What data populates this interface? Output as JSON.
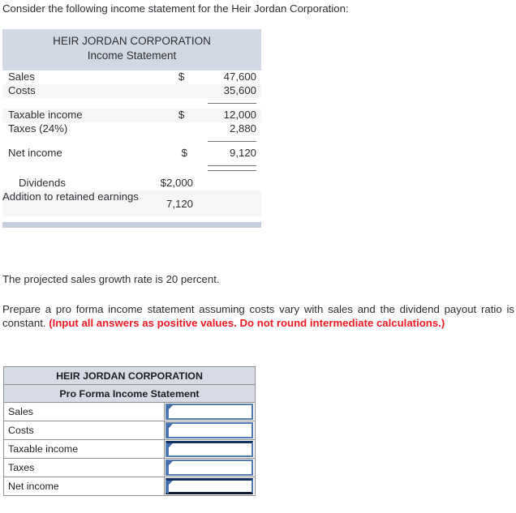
{
  "intro": {
    "text": "Consider the following income statement for the Heir Jordan Corporation:"
  },
  "income_statement": {
    "company": "HEIR JORDAN CORPORATION",
    "subtitle": "Income Statement",
    "rows": [
      {
        "label": "Sales",
        "currency": "$",
        "value": "47,600"
      },
      {
        "label": "Costs",
        "currency": "",
        "value": "35,600"
      },
      {
        "label": "Taxable income",
        "currency": "$",
        "value": "12,000"
      },
      {
        "label": "Taxes (24%)",
        "currency": "",
        "value": "2,880"
      },
      {
        "label": "Net income",
        "currency": "$",
        "value": "9,120"
      }
    ],
    "dividends_label": "Dividends",
    "dividends_value": "$2,000",
    "addition_label": "Addition to retained earnings",
    "addition_value": "7,120"
  },
  "growth": {
    "text": "The projected sales growth rate is 20 percent."
  },
  "prompt": {
    "text": "Prepare a pro forma income statement assuming costs vary with sales and the dividend payout ratio is constant. ",
    "emphasis": "(Input all answers as positive values. Do not round intermediate calculations.)"
  },
  "pro_forma": {
    "company": "HEIR JORDAN CORPORATION",
    "subtitle": "Pro Forma Income Statement",
    "rows": [
      {
        "label": "Sales",
        "value": ""
      },
      {
        "label": "Costs",
        "value": ""
      },
      {
        "label": "Taxable income",
        "value": ""
      },
      {
        "label": "Taxes",
        "value": ""
      },
      {
        "label": "Net income",
        "value": ""
      }
    ]
  },
  "colors": {
    "header_band": "#d3d9e4",
    "pf_header_band": "#d6dbe6",
    "emphasis_red": "#ee1b24",
    "input_border": "#507ab0",
    "input_border_dark": "#123163",
    "footer_bar": "#c7cedd"
  }
}
